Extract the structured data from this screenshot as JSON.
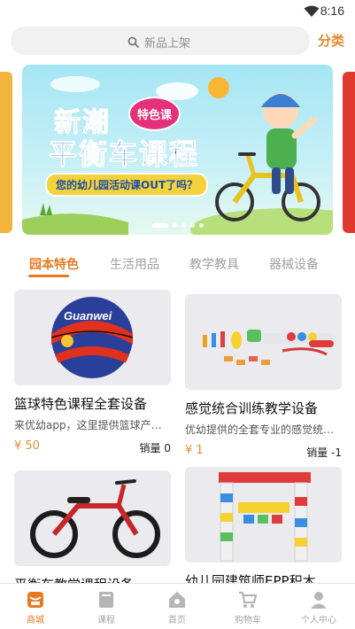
{
  "status": {
    "time": "8:16"
  },
  "search": {
    "placeholder": "新品上架",
    "category_link": "分类"
  },
  "banner": {
    "title_line1": "新潮",
    "badge": "特色课",
    "title_line2": "平衡车课程",
    "subtitle": "您的幼儿园活动课OUT了吗？",
    "dots": 5,
    "active_dot": 0
  },
  "tabs": [
    {
      "label": "园本特色",
      "active": true
    },
    {
      "label": "生活用品",
      "active": false
    },
    {
      "label": "教学教具",
      "active": false
    },
    {
      "label": "器械设备",
      "active": false
    }
  ],
  "products": [
    {
      "title": "篮球特色课程全套设备",
      "desc": "来优幼app，这里提供篮球产品…",
      "price": "¥ 50",
      "sales": "销量 0",
      "image": "basketball",
      "image_text": "Guanwei"
    },
    {
      "title": "感觉统合训练教学设备",
      "desc": "优幼提供的全套专业的感觉统…",
      "price": "¥ 1",
      "sales": "销量 -1",
      "image": "sensory-equipment"
    },
    {
      "title": "平衡车教学课程设备…",
      "image": "balance-bike"
    },
    {
      "title": "幼儿园建筑师EPP积木",
      "image": "epp-blocks"
    }
  ],
  "bottom_nav": [
    {
      "label": "商城",
      "icon": "store-icon",
      "active": true
    },
    {
      "label": "课程",
      "icon": "book-icon",
      "active": false
    },
    {
      "label": "首页",
      "icon": "home-icon",
      "active": false
    },
    {
      "label": "购物车",
      "icon": "cart-icon",
      "active": false
    },
    {
      "label": "个人中心",
      "icon": "user-icon",
      "active": false
    }
  ],
  "colors": {
    "accent": "#e67a22",
    "banner_blue": "#1a6ad1",
    "price": "#e88a35"
  }
}
